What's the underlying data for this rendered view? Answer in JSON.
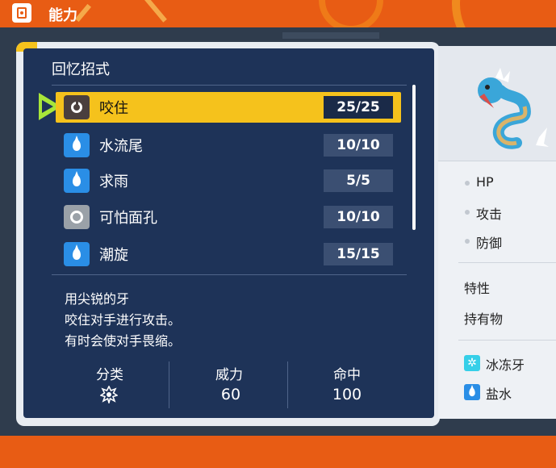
{
  "header": {
    "title": "能力"
  },
  "panel": {
    "title": "回忆招式"
  },
  "moves": [
    {
      "name": "咬住",
      "pp": "25/25",
      "type_icon": "dark-type-icon",
      "selected": true
    },
    {
      "name": "水流尾",
      "pp": "10/10",
      "type_icon": "water-type-icon",
      "selected": false
    },
    {
      "name": "求雨",
      "pp": "5/5",
      "type_icon": "water-type-icon",
      "selected": false
    },
    {
      "name": "可怕面孔",
      "pp": "10/10",
      "type_icon": "normal-type-icon",
      "selected": false
    },
    {
      "name": "潮旋",
      "pp": "15/15",
      "type_icon": "water-type-icon",
      "selected": false
    }
  ],
  "description": {
    "line1": "用尖锐的牙",
    "line2": "咬住对手进行攻击。",
    "line3": "有时会使对手畏缩。"
  },
  "stats": {
    "category_label": "分类",
    "category_icon": "physical-category-icon",
    "power_label": "威力",
    "power_value": "60",
    "accuracy_label": "命中",
    "accuracy_value": "100"
  },
  "pokemon_summary": {
    "hp_label": "HP",
    "attack_label": "攻击",
    "defense_label": "防御",
    "ability_label": "特性",
    "held_item_label": "持有物",
    "known_moves": [
      {
        "name": "冰冻牙",
        "type_icon": "ice-type-icon"
      },
      {
        "name": "盐水",
        "type_icon": "water-type-icon"
      }
    ]
  },
  "colors": {
    "accent_orange": "#e85c14",
    "panel_navy": "#1e3358",
    "selected_yellow": "#f5c21c",
    "water_blue": "#2a8ee6"
  }
}
